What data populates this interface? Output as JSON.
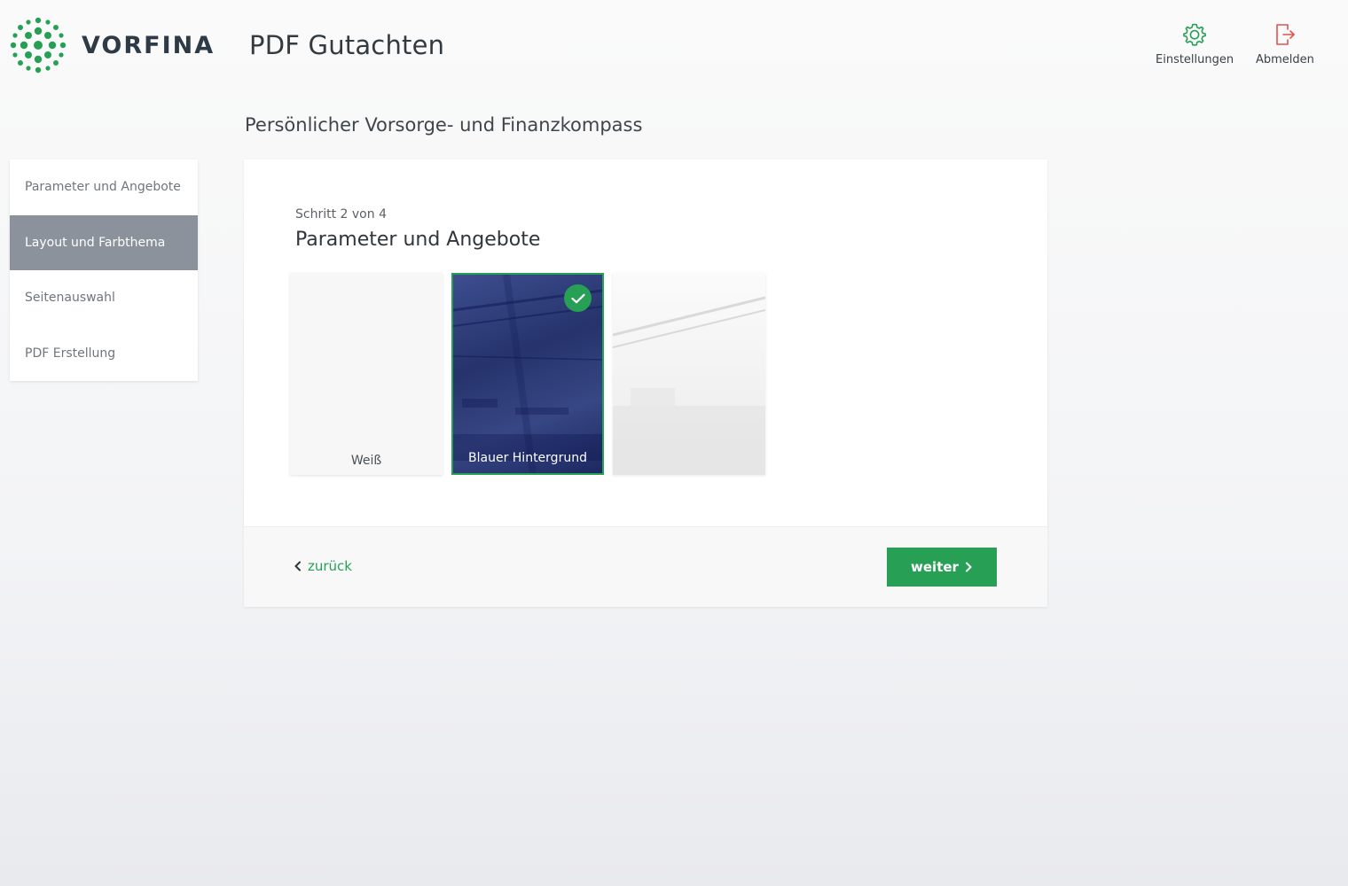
{
  "brand": {
    "name": "VORFINA",
    "logo_icon": "dots-logo-icon",
    "color": "#27a055"
  },
  "app_title": "PDF Gutachten",
  "header": {
    "settings": {
      "label": "Einstellungen",
      "icon": "gear-icon"
    },
    "logout": {
      "label": "Abmelden",
      "icon": "logout-icon"
    }
  },
  "page_subtitle": "Persönlicher Vorsorge- und Finanzkompass",
  "sidebar": {
    "items": [
      {
        "label": "Parameter und Angebote",
        "active": false
      },
      {
        "label": "Layout und Farbthema",
        "active": true
      },
      {
        "label": "Seitenauswahl",
        "active": false
      },
      {
        "label": "PDF Erstellung",
        "active": false
      }
    ]
  },
  "wizard": {
    "step_label": "Schritt 2 von 4",
    "title": "Parameter und Angebote",
    "themes": [
      {
        "label": "Weiß",
        "selected": false
      },
      {
        "label": "Blauer Hintergrund",
        "selected": true,
        "icon": "check-icon"
      },
      {
        "label": "",
        "selected": false
      }
    ]
  },
  "footer": {
    "back_label": "zurück",
    "next_label": "weiter"
  }
}
